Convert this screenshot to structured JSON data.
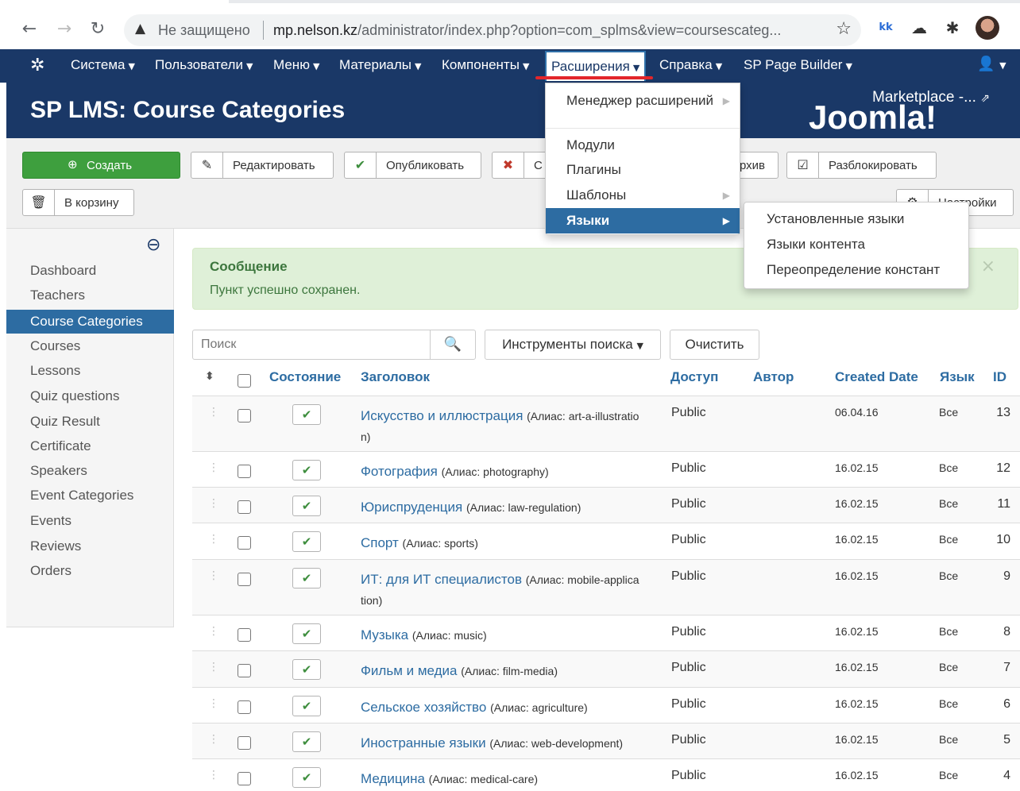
{
  "browser": {
    "not_secure": "Не защищено",
    "url_host": "mp.nelson.kz",
    "url_path": "/administrator/index.php?option=com_splms&view=coursescateg..."
  },
  "topnav": {
    "items": [
      {
        "label": "Система"
      },
      {
        "label": "Пользователи"
      },
      {
        "label": "Меню"
      },
      {
        "label": "Материалы"
      },
      {
        "label": "Компоненты"
      },
      {
        "label": "Расширения"
      },
      {
        "label": "Справка"
      },
      {
        "label": "SP Page Builder"
      }
    ]
  },
  "header": {
    "title": "SP LMS: Course Categories",
    "marketplace": "Marketplace -...",
    "logo_text": "Joomla!"
  },
  "toolbar": {
    "create": "Создать",
    "edit": "Редактировать",
    "publish": "Опубликовать",
    "unpublish": "С",
    "archive": "рхив",
    "unlock": "Разблокировать",
    "trash": "В корзину",
    "options": "Настройки"
  },
  "sidebar": {
    "items": [
      {
        "label": "Dashboard"
      },
      {
        "label": "Teachers"
      },
      {
        "label": "Course Categories",
        "active": true
      },
      {
        "label": "Courses"
      },
      {
        "label": "Lessons"
      },
      {
        "label": "Quiz questions"
      },
      {
        "label": "Quiz Result"
      },
      {
        "label": "Certificate"
      },
      {
        "label": "Speakers"
      },
      {
        "label": "Event Categories"
      },
      {
        "label": "Events"
      },
      {
        "label": "Reviews"
      },
      {
        "label": "Orders"
      }
    ]
  },
  "message": {
    "title": "Сообщение",
    "text": "Пункт успешно сохранен.",
    "close": "×"
  },
  "search": {
    "placeholder": "Поиск",
    "tools": "Инструменты поиска",
    "clear": "Очистить"
  },
  "table": {
    "headers": {
      "state": "Состояние",
      "title": "Заголовок",
      "access": "Доступ",
      "author": "Автор",
      "created": "Created Date",
      "language": "Язык",
      "id": "ID"
    },
    "alias_prefix": "(Алиас: ",
    "rows": [
      {
        "title": "Искусство и иллюстрация",
        "alias": "art-a-illustratio",
        "alias2": "n)",
        "access": "Public",
        "date": "06.04.16",
        "lang": "Все",
        "id": "13"
      },
      {
        "title": "Фотография",
        "alias": "photography)",
        "access": "Public",
        "date": "16.02.15",
        "lang": "Все",
        "id": "12"
      },
      {
        "title": "Юриспруденция",
        "alias": "law-regulation)",
        "access": "Public",
        "date": "16.02.15",
        "lang": "Все",
        "id": "11"
      },
      {
        "title": "Спорт",
        "alias": "sports)",
        "access": "Public",
        "date": "16.02.15",
        "lang": "Все",
        "id": "10"
      },
      {
        "title": "ИТ: для ИТ специалистов",
        "alias": "mobile-applica",
        "alias2": "tion)",
        "access": "Public",
        "date": "16.02.15",
        "lang": "Все",
        "id": "9"
      },
      {
        "title": "Музыка",
        "alias": "music)",
        "access": "Public",
        "date": "16.02.15",
        "lang": "Все",
        "id": "8"
      },
      {
        "title": "Фильм и медиа",
        "alias": "film-media)",
        "access": "Public",
        "date": "16.02.15",
        "lang": "Все",
        "id": "7"
      },
      {
        "title": "Сельское хозяйство",
        "alias": "agriculture)",
        "access": "Public",
        "date": "16.02.15",
        "lang": "Все",
        "id": "6"
      },
      {
        "title": "Иностранные языки",
        "alias": "web-development)",
        "access": "Public",
        "date": "16.02.15",
        "lang": "Все",
        "id": "5"
      },
      {
        "title": "Медицина",
        "alias": "medical-care)",
        "access": "Public",
        "date": "16.02.15",
        "lang": "Все",
        "id": "4"
      }
    ]
  },
  "dropdown": {
    "items": [
      {
        "label": "Менеджер расширений"
      },
      {
        "label": "Модули"
      },
      {
        "label": "Плагины"
      },
      {
        "label": "Шаблоны"
      },
      {
        "label": "Языки"
      }
    ],
    "submenu": [
      {
        "label": "Установленные языки"
      },
      {
        "label": "Языки контента"
      },
      {
        "label": "Переопределение констант"
      }
    ]
  },
  "colors": {
    "navy": "#1a3867",
    "link": "#2d6ca2",
    "success_bg": "#dff0d8",
    "create_green": "#3e9f3e",
    "highlight_red": "#e3262b"
  }
}
